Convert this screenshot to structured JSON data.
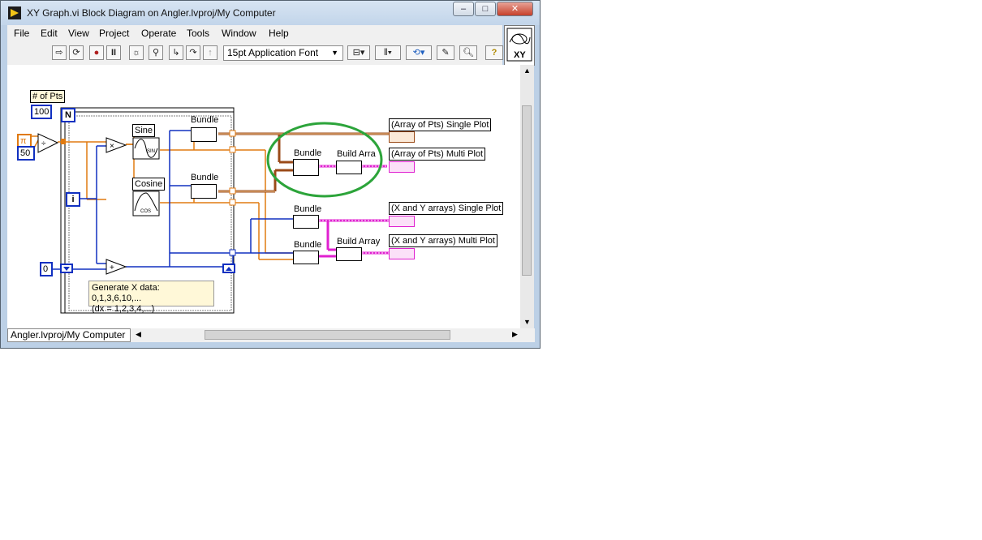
{
  "window": {
    "title": "XY Graph.vi Block Diagram on Angler.lvproj/My Computer",
    "controls": [
      "–",
      "□",
      "✕"
    ]
  },
  "menu": [
    "File",
    "Edit",
    "View",
    "Project",
    "Operate",
    "Tools",
    "Window",
    "Help"
  ],
  "toolbar": {
    "font": "15pt Application Font",
    "icons": [
      "run-arrow-icon",
      "run-continuous-icon",
      "abort-icon",
      "pause-icon",
      "highlight-execution-icon",
      "retain-wire-values-icon",
      "step-into-icon",
      "step-over-icon",
      "step-out-icon",
      "align-icon",
      "distribute-icon",
      "reorder-icon",
      "cleanup-icon",
      "search-icon",
      "help-icon"
    ]
  },
  "vi_icon": {
    "text": "XY"
  },
  "diagram": {
    "num_pts_label": "# of Pts",
    "const_100": "100",
    "const_50": "50",
    "const_0": "0",
    "pi_symbol": "π",
    "n_terminal": "N",
    "i_terminal": "i",
    "sine_label": "Sine",
    "sine_sub": "SIN",
    "cosine_label": "Cosine",
    "cosine_sub": "COS",
    "bundle_label": "Bundle",
    "build_array_label": "Build Array",
    "build_array_clipped": "Build Arra",
    "comment_line1": "Generate X data:  0,1,3,6,10,...",
    "comment_line2": "(dx = 1,2,3,4,...)",
    "indicators": [
      "(Array of Pts) Single Plot",
      "(Array of Pts) Multi Plot",
      "(X and Y arrays) Single Plot",
      "(X and Y arrays) Multi Plot"
    ],
    "highlight_color": "#2ca43a"
  },
  "status": {
    "project": "Angler.lvproj/My Computer"
  },
  "colors": {
    "wire_orange": "#e07a10",
    "wire_blue": "#1030c0",
    "wire_brown": "#9a4a18",
    "wire_pink": "#e020d0"
  }
}
